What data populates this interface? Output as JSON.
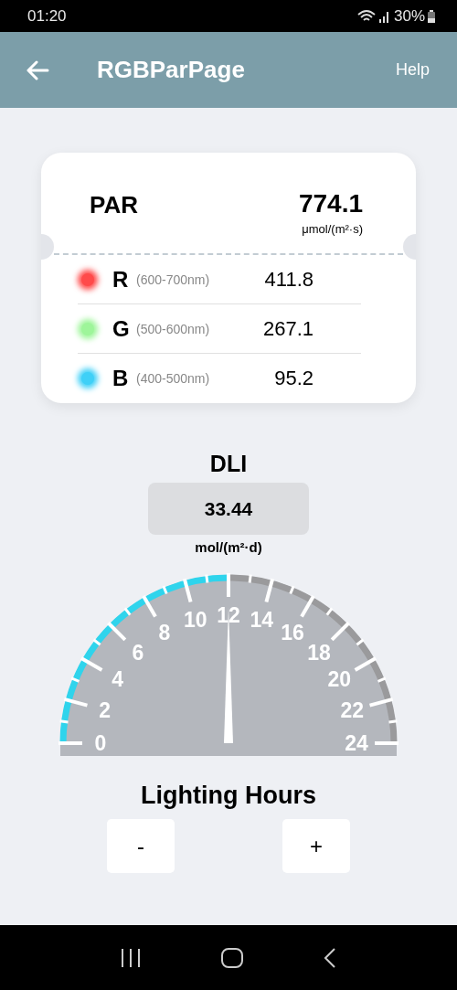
{
  "status_bar": {
    "time": "01:20",
    "battery": "30%"
  },
  "app_bar": {
    "title": "RGBParPage",
    "action": "Help"
  },
  "par": {
    "label": "PAR",
    "value": "774.1",
    "unit": "μmol/(m²·s)"
  },
  "bands": [
    {
      "letter": "R",
      "range": "(600-700nm)",
      "value": "411.8",
      "color": "#ff4a4a"
    },
    {
      "letter": "G",
      "range": "(500-600nm)",
      "value": "267.1",
      "color": "#9ef59a"
    },
    {
      "letter": "B",
      "range": "(400-500nm)",
      "value": "95.2",
      "color": "#3fd0f7"
    }
  ],
  "dli": {
    "label": "DLI",
    "value": "33.44",
    "unit": "mol/(m²·d)"
  },
  "gauge": {
    "labels": [
      "0",
      "2",
      "4",
      "6",
      "8",
      "10",
      "12",
      "14",
      "16",
      "18",
      "20",
      "22",
      "24"
    ]
  },
  "lighting": {
    "label": "Lighting Hours",
    "buttons": [
      "-",
      "+"
    ]
  }
}
